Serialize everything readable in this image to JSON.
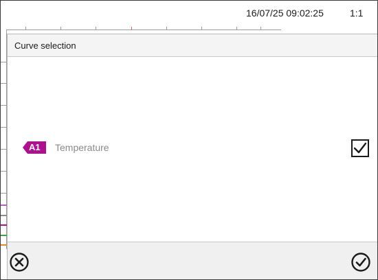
{
  "status_bar": {
    "datetime": "16/07/25 09:02:25",
    "ratio": "1:1"
  },
  "dialog": {
    "title": "Curve selection",
    "curves": [
      {
        "badge": "A1",
        "label": "Temperature",
        "checked": true,
        "badge_color": "#b0108f"
      }
    ],
    "cancel_icon": "cancel-circle-icon",
    "confirm_icon": "check-circle-icon"
  },
  "colors": {
    "curve_a1": "#b0108f",
    "text_disabled": "#8a8a8a",
    "footer_bg": "#f0f0f0",
    "header_bg": "#f4f4f4"
  }
}
